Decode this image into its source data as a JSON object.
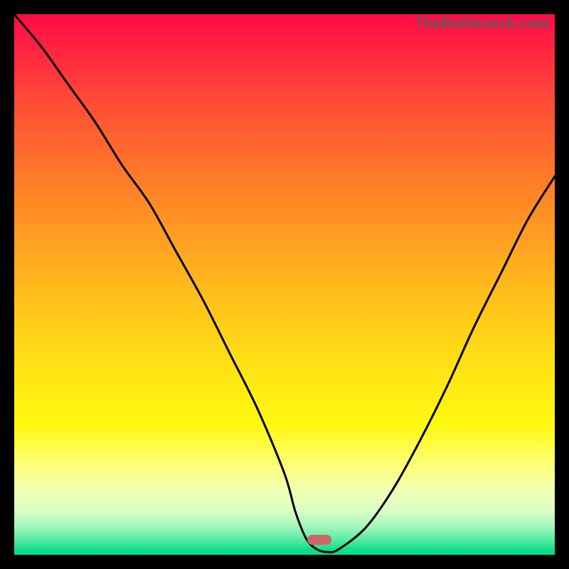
{
  "watermark": "TheBottleneck.com",
  "chart_data": {
    "type": "line",
    "title": "",
    "xlabel": "",
    "ylabel": "",
    "ylim": [
      0,
      100
    ],
    "x": [
      0,
      5,
      10,
      15,
      20,
      25,
      30,
      35,
      40,
      45,
      50,
      52,
      54,
      56,
      58,
      60,
      65,
      70,
      75,
      80,
      85,
      90,
      95,
      100
    ],
    "values": [
      100,
      94,
      87,
      80,
      72,
      65,
      56,
      47,
      37,
      27,
      15,
      8,
      3,
      1,
      0.5,
      1,
      5,
      12,
      21,
      31,
      42,
      52,
      62,
      70
    ],
    "minimum_x": 56,
    "marker": {
      "x_pct": 56.5,
      "y_pct": 97.2,
      "color": "#cc6666"
    }
  },
  "colors": {
    "curve": "#000000",
    "marker": "#cc6666",
    "frame": "#000000"
  }
}
